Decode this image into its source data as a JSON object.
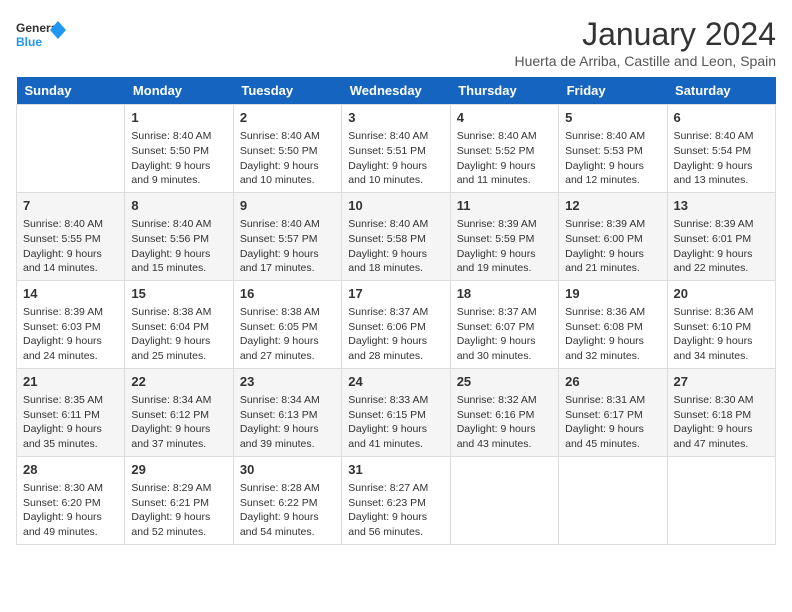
{
  "logo": {
    "line1": "General",
    "line2": "Blue"
  },
  "title": "January 2024",
  "subtitle": "Huerta de Arriba, Castille and Leon, Spain",
  "days_of_week": [
    "Sunday",
    "Monday",
    "Tuesday",
    "Wednesday",
    "Thursday",
    "Friday",
    "Saturday"
  ],
  "weeks": [
    [
      {
        "day": "",
        "info": ""
      },
      {
        "day": "1",
        "info": "Sunrise: 8:40 AM\nSunset: 5:50 PM\nDaylight: 9 hours\nand 9 minutes."
      },
      {
        "day": "2",
        "info": "Sunrise: 8:40 AM\nSunset: 5:50 PM\nDaylight: 9 hours\nand 10 minutes."
      },
      {
        "day": "3",
        "info": "Sunrise: 8:40 AM\nSunset: 5:51 PM\nDaylight: 9 hours\nand 10 minutes."
      },
      {
        "day": "4",
        "info": "Sunrise: 8:40 AM\nSunset: 5:52 PM\nDaylight: 9 hours\nand 11 minutes."
      },
      {
        "day": "5",
        "info": "Sunrise: 8:40 AM\nSunset: 5:53 PM\nDaylight: 9 hours\nand 12 minutes."
      },
      {
        "day": "6",
        "info": "Sunrise: 8:40 AM\nSunset: 5:54 PM\nDaylight: 9 hours\nand 13 minutes."
      }
    ],
    [
      {
        "day": "7",
        "info": "Sunrise: 8:40 AM\nSunset: 5:55 PM\nDaylight: 9 hours\nand 14 minutes."
      },
      {
        "day": "8",
        "info": "Sunrise: 8:40 AM\nSunset: 5:56 PM\nDaylight: 9 hours\nand 15 minutes."
      },
      {
        "day": "9",
        "info": "Sunrise: 8:40 AM\nSunset: 5:57 PM\nDaylight: 9 hours\nand 17 minutes."
      },
      {
        "day": "10",
        "info": "Sunrise: 8:40 AM\nSunset: 5:58 PM\nDaylight: 9 hours\nand 18 minutes."
      },
      {
        "day": "11",
        "info": "Sunrise: 8:39 AM\nSunset: 5:59 PM\nDaylight: 9 hours\nand 19 minutes."
      },
      {
        "day": "12",
        "info": "Sunrise: 8:39 AM\nSunset: 6:00 PM\nDaylight: 9 hours\nand 21 minutes."
      },
      {
        "day": "13",
        "info": "Sunrise: 8:39 AM\nSunset: 6:01 PM\nDaylight: 9 hours\nand 22 minutes."
      }
    ],
    [
      {
        "day": "14",
        "info": "Sunrise: 8:39 AM\nSunset: 6:03 PM\nDaylight: 9 hours\nand 24 minutes."
      },
      {
        "day": "15",
        "info": "Sunrise: 8:38 AM\nSunset: 6:04 PM\nDaylight: 9 hours\nand 25 minutes."
      },
      {
        "day": "16",
        "info": "Sunrise: 8:38 AM\nSunset: 6:05 PM\nDaylight: 9 hours\nand 27 minutes."
      },
      {
        "day": "17",
        "info": "Sunrise: 8:37 AM\nSunset: 6:06 PM\nDaylight: 9 hours\nand 28 minutes."
      },
      {
        "day": "18",
        "info": "Sunrise: 8:37 AM\nSunset: 6:07 PM\nDaylight: 9 hours\nand 30 minutes."
      },
      {
        "day": "19",
        "info": "Sunrise: 8:36 AM\nSunset: 6:08 PM\nDaylight: 9 hours\nand 32 minutes."
      },
      {
        "day": "20",
        "info": "Sunrise: 8:36 AM\nSunset: 6:10 PM\nDaylight: 9 hours\nand 34 minutes."
      }
    ],
    [
      {
        "day": "21",
        "info": "Sunrise: 8:35 AM\nSunset: 6:11 PM\nDaylight: 9 hours\nand 35 minutes."
      },
      {
        "day": "22",
        "info": "Sunrise: 8:34 AM\nSunset: 6:12 PM\nDaylight: 9 hours\nand 37 minutes."
      },
      {
        "day": "23",
        "info": "Sunrise: 8:34 AM\nSunset: 6:13 PM\nDaylight: 9 hours\nand 39 minutes."
      },
      {
        "day": "24",
        "info": "Sunrise: 8:33 AM\nSunset: 6:15 PM\nDaylight: 9 hours\nand 41 minutes."
      },
      {
        "day": "25",
        "info": "Sunrise: 8:32 AM\nSunset: 6:16 PM\nDaylight: 9 hours\nand 43 minutes."
      },
      {
        "day": "26",
        "info": "Sunrise: 8:31 AM\nSunset: 6:17 PM\nDaylight: 9 hours\nand 45 minutes."
      },
      {
        "day": "27",
        "info": "Sunrise: 8:30 AM\nSunset: 6:18 PM\nDaylight: 9 hours\nand 47 minutes."
      }
    ],
    [
      {
        "day": "28",
        "info": "Sunrise: 8:30 AM\nSunset: 6:20 PM\nDaylight: 9 hours\nand 49 minutes."
      },
      {
        "day": "29",
        "info": "Sunrise: 8:29 AM\nSunset: 6:21 PM\nDaylight: 9 hours\nand 52 minutes."
      },
      {
        "day": "30",
        "info": "Sunrise: 8:28 AM\nSunset: 6:22 PM\nDaylight: 9 hours\nand 54 minutes."
      },
      {
        "day": "31",
        "info": "Sunrise: 8:27 AM\nSunset: 6:23 PM\nDaylight: 9 hours\nand 56 minutes."
      },
      {
        "day": "",
        "info": ""
      },
      {
        "day": "",
        "info": ""
      },
      {
        "day": "",
        "info": ""
      }
    ]
  ]
}
